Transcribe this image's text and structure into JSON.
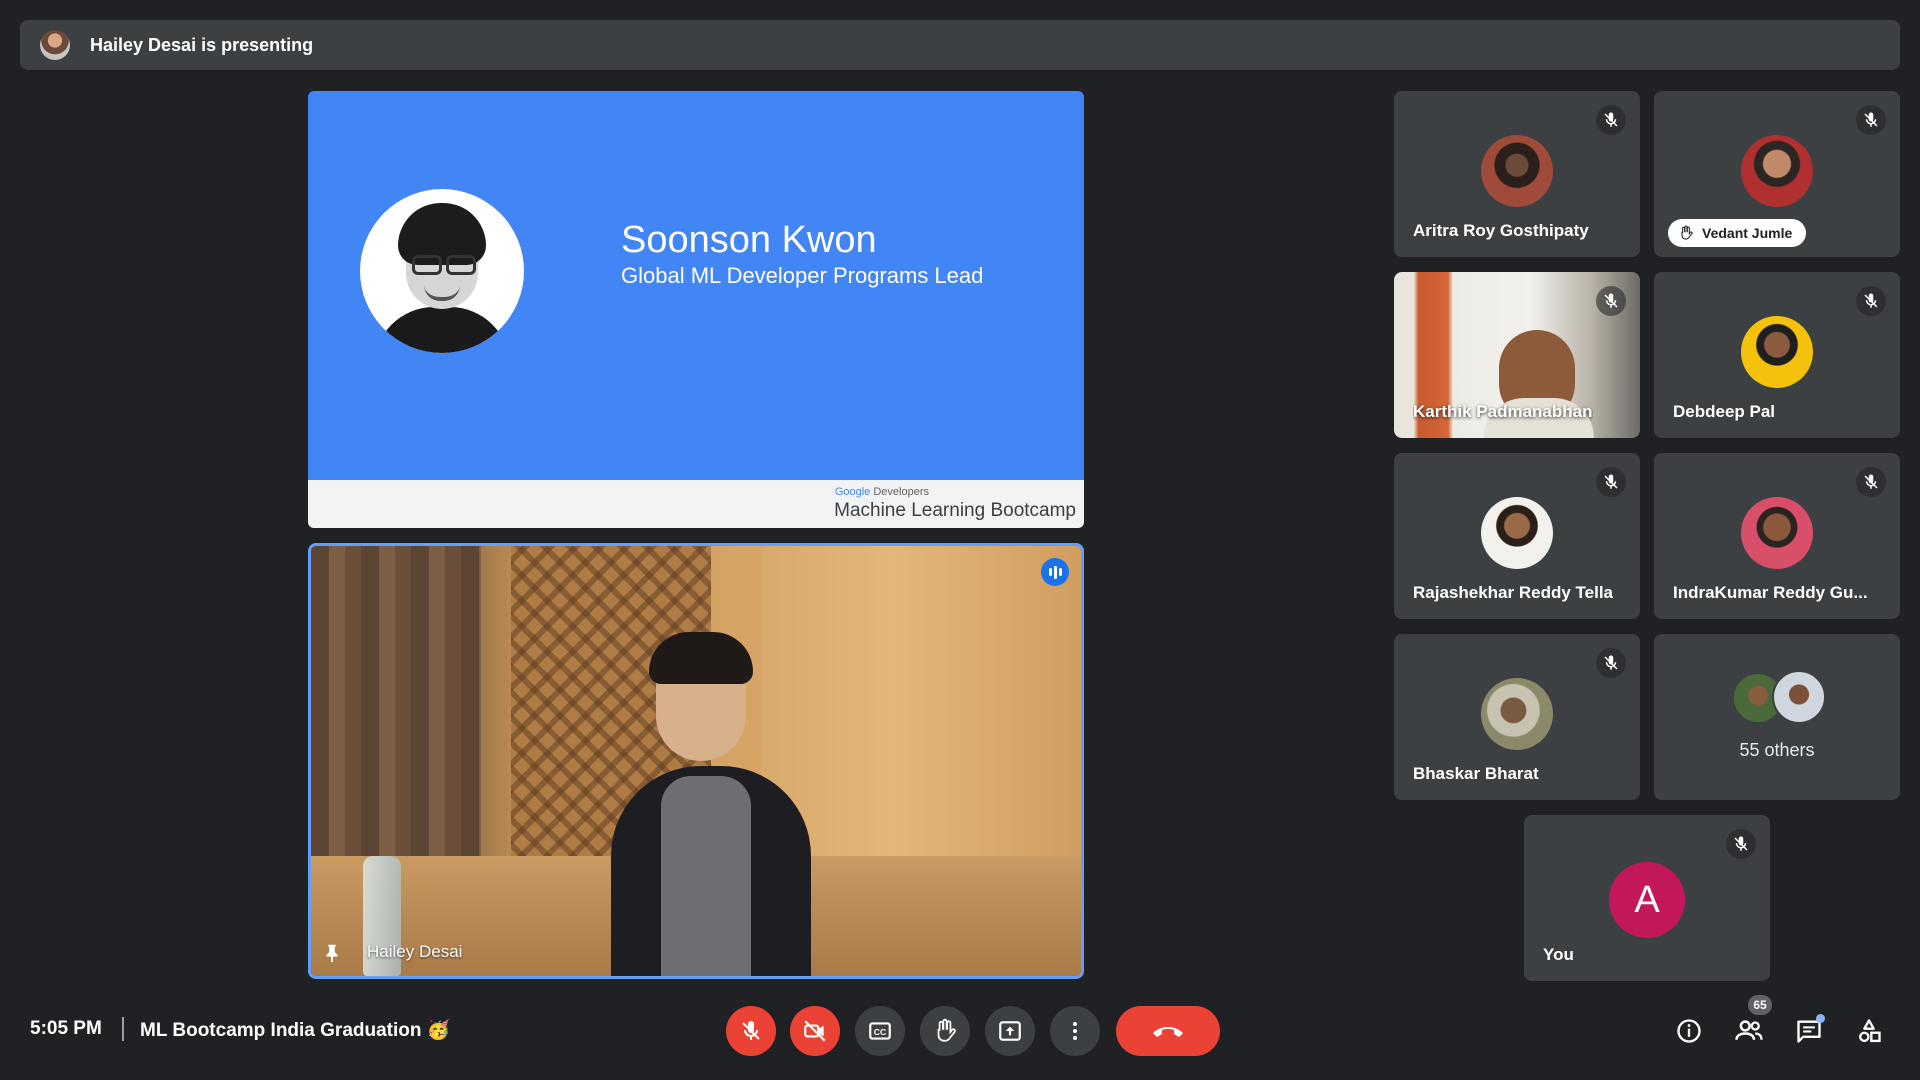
{
  "banner": {
    "text": "Hailey Desai is presenting"
  },
  "slide": {
    "speaker_name": "Soonson Kwon",
    "speaker_role": "Global ML Developer Programs Lead",
    "footer_brand_google": "Google",
    "footer_brand_developers": "Developers",
    "footer_title": "Machine Learning Bootcamp"
  },
  "speaker_tile": {
    "name": "Hailey Desai"
  },
  "participants": [
    {
      "name": "Aritra Roy Gosthipaty",
      "muted": true
    },
    {
      "name": "Vedant Jumle",
      "muted": true,
      "hand_raised": true
    },
    {
      "name": "Karthik Padmanabhan",
      "muted": true,
      "video_on": true
    },
    {
      "name": "Debdeep Pal",
      "muted": true
    },
    {
      "name": "Rajashekhar Reddy Tella",
      "muted": true
    },
    {
      "name": "IndraKumar Reddy Gu...",
      "muted": true
    },
    {
      "name": "Bhaskar Bharat",
      "muted": true
    }
  ],
  "others": {
    "label": "55 others"
  },
  "self_tile": {
    "name": "You",
    "initial": "A",
    "color": "#c2185b",
    "muted": true
  },
  "bottom_bar": {
    "time": "5:05 PM",
    "meeting_title": "ML Bootcamp India Graduation",
    "meeting_emoji": "🥳",
    "people_count": "65"
  },
  "colors": {
    "background": "#202124",
    "tile": "#3c4043",
    "danger": "#ea4335",
    "accent": "#1a73e8",
    "slide_blue": "#4285f4"
  },
  "icons": {
    "controls": [
      "mic-off-icon",
      "videocam-off-icon",
      "captions-icon",
      "raise-hand-icon",
      "present-screen-icon",
      "more-options-icon",
      "end-call-icon"
    ],
    "right": [
      "info-icon",
      "people-icon",
      "chat-icon",
      "activities-icon"
    ]
  }
}
